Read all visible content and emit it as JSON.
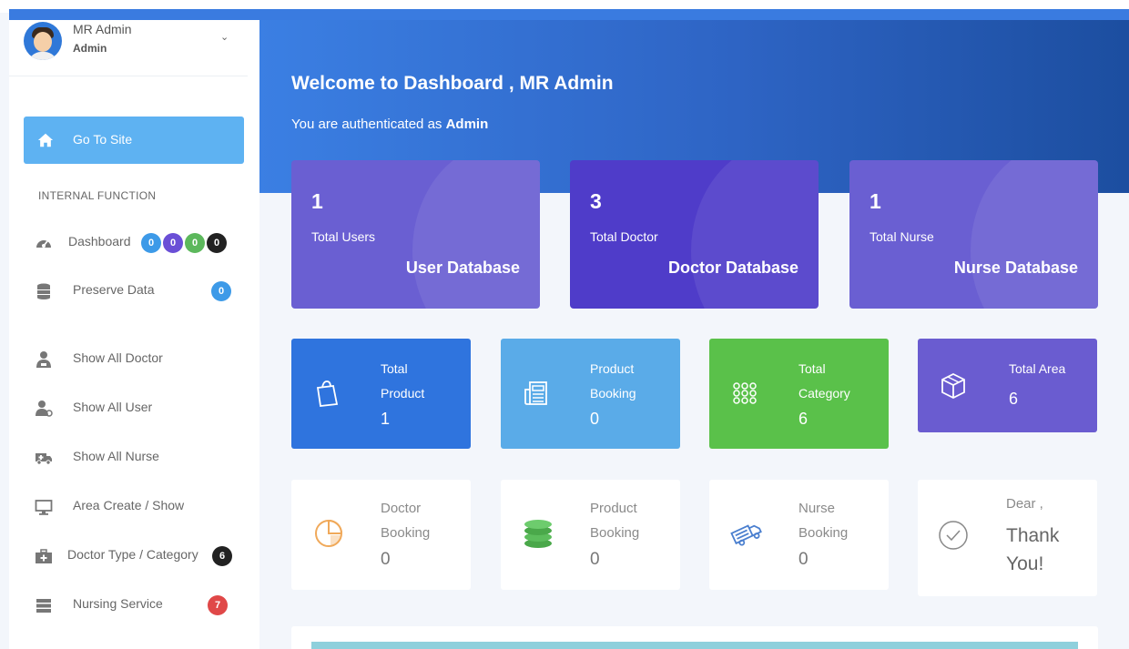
{
  "user": {
    "name": "MR Admin",
    "role": "Admin",
    "caret": "⌄"
  },
  "sidebar": {
    "go_to_site": "Go To Site",
    "section_title": "INTERNAL FUNCTION",
    "items": [
      {
        "label": "Dashboard",
        "badges": [
          "0",
          "0",
          "0",
          "0"
        ]
      },
      {
        "label": "Preserve Data",
        "badge": "0"
      },
      {
        "label": "Show All Doctor"
      },
      {
        "label": "Show All User"
      },
      {
        "label": "Show All Nurse"
      },
      {
        "label": "Area Create / Show"
      },
      {
        "label": "Doctor Type / Category",
        "badge": "6"
      },
      {
        "label": "Nursing Service",
        "badge": "7"
      }
    ]
  },
  "hero": {
    "title": "Welcome to Dashboard , MR Admin",
    "subtitle_prefix": "You are authenticated as",
    "subtitle_role": "Admin"
  },
  "db_cards": [
    {
      "count": "1",
      "name": "Total Users",
      "db": "User Database",
      "color": "#6a5fd2"
    },
    {
      "count": "3",
      "name": "Total Doctor",
      "db": "Doctor Database",
      "color": "#4f3cc9"
    },
    {
      "count": "1",
      "name": "Total Nurse",
      "db": "Nurse Database",
      "color": "#6a5fd2"
    }
  ],
  "stat_cards": [
    {
      "line1": "Total",
      "line2": "Product",
      "value": "1",
      "icon": "shopping-bag-icon",
      "color": "#2f74de"
    },
    {
      "line1": "Product",
      "line2": "Booking",
      "value": "0",
      "icon": "newspaper-icon",
      "color": "#5aabe8"
    },
    {
      "line1": "Total",
      "line2": "Category",
      "value": "6",
      "icon": "grid-dots-icon",
      "color": "#5ac14a"
    },
    {
      "line1": "Total Area",
      "line2": "",
      "value": "6",
      "icon": "box-icon",
      "color": "#6a5cd0"
    }
  ],
  "soft_cards": [
    {
      "line1": "Doctor",
      "line2": "Booking",
      "value": "0",
      "icon": "pie-chart-icon"
    },
    {
      "line1": "Product",
      "line2": "Booking",
      "value": "0",
      "icon": "coins-icon"
    },
    {
      "line1": "Nurse",
      "line2": "Booking",
      "value": "0",
      "icon": "truck-icon"
    },
    {
      "line1": "Dear ,",
      "line2": "Thank",
      "value": "You!",
      "icon": "check-circle-icon"
    }
  ],
  "badge_colors": {
    "dashboard": [
      "#3d9ae8",
      "#6a4fd6",
      "#5cb85c",
      "#222222"
    ],
    "preserve": "#3d9ae8",
    "doctor_type": "#222222",
    "nursing": "#e04848"
  }
}
